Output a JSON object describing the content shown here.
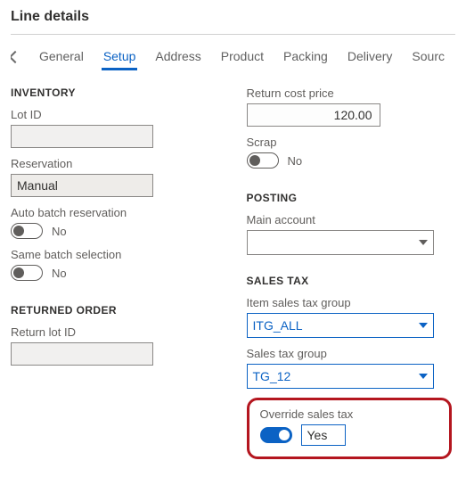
{
  "title": "Line details",
  "tabs": {
    "items": [
      "General",
      "Setup",
      "Address",
      "Product",
      "Packing",
      "Delivery",
      "Sourc"
    ],
    "activeIndex": 1
  },
  "left": {
    "inventory": {
      "heading": "INVENTORY",
      "lot_id": {
        "label": "Lot ID",
        "value": ""
      },
      "reservation": {
        "label": "Reservation",
        "value": "Manual"
      },
      "auto_batch": {
        "label": "Auto batch reservation",
        "value": "No",
        "on": false
      },
      "same_batch": {
        "label": "Same batch selection",
        "value": "No",
        "on": false
      }
    },
    "returned_order": {
      "heading": "RETURNED ORDER",
      "return_lot": {
        "label": "Return lot ID",
        "value": ""
      }
    }
  },
  "right": {
    "return_cost": {
      "label": "Return cost price",
      "value": "120.00"
    },
    "scrap": {
      "label": "Scrap",
      "value": "No",
      "on": false
    },
    "posting": {
      "heading": "POSTING",
      "main_account": {
        "label": "Main account",
        "value": ""
      }
    },
    "sales_tax": {
      "heading": "SALES TAX",
      "item_group": {
        "label": "Item sales tax group",
        "value": "ITG_ALL"
      },
      "tax_group": {
        "label": "Sales tax group",
        "value": "TG_12"
      },
      "override": {
        "label": "Override sales tax",
        "value": "Yes",
        "on": true
      }
    }
  }
}
